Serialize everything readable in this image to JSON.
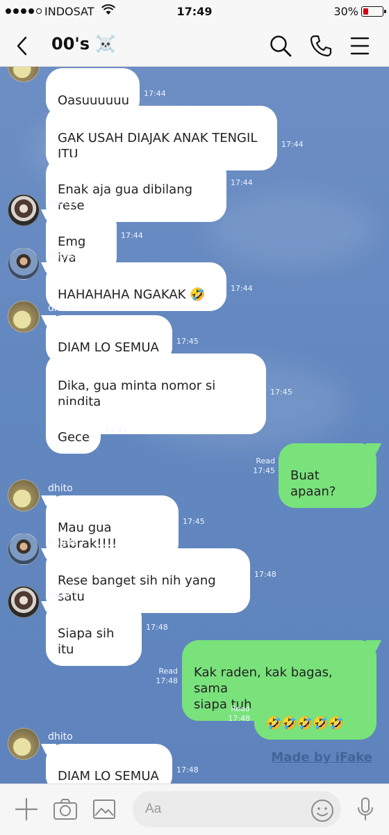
{
  "status_bar": {
    "carrier": "INDOSAT",
    "time": "17:49",
    "battery": "30%",
    "battery_level": 0.3
  },
  "header": {
    "title": "00's ☠️"
  },
  "messages": [
    {
      "text": "Oasuuuuuu",
      "time": "17:44"
    },
    {
      "text": "GAK USAH DIAJAK ANAK TENGIL\nITU",
      "time": "17:44"
    },
    {
      "text": "Enak aja gua dibilang rese",
      "time": "17:44"
    },
    {
      "sender": "raden",
      "text": "Emg iya",
      "time": "17:44"
    },
    {
      "sender": "bagas",
      "text": "HAHAHAHA NGAKAK 🤣",
      "time": "17:44"
    },
    {
      "sender": "dhito",
      "text": "DIAM LO SEMUA",
      "time": "17:45"
    },
    {
      "text": "Dika, gua minta nomor si nindita\nitu",
      "time": "17:45"
    },
    {
      "text": "Gece",
      "time": "17:45"
    },
    {
      "text": "Buat apaan?",
      "time": "17:45",
      "read": "Read"
    },
    {
      "sender": "dhito",
      "text": "Mau gua labrak!!!!",
      "time": "17:45"
    },
    {
      "sender": "bagas",
      "text": "Rese banget sih nih yang satu",
      "time": "17:48"
    },
    {
      "sender": "raden",
      "text": "Siapa sih itu",
      "time": "17:48"
    },
    {
      "text": "Kak raden, kak bagas, sama\nsiapa tuh yang rese",
      "time": "17:48",
      "read": "Read"
    },
    {
      "text": "🤣🤣🤣🤣🤣",
      "time": "17:48",
      "read": "Read"
    },
    {
      "sender": "dhito",
      "text": "DIAM LO SEMUA",
      "time": "17:48"
    }
  ],
  "watermark": "Made by iFake",
  "input": {
    "placeholder": "Aa"
  },
  "icons": [
    "back-icon",
    "search-icon",
    "phone-icon",
    "menu-icon",
    "plus-icon",
    "camera-icon",
    "image-icon",
    "sticker-icon",
    "mic-icon"
  ],
  "colors": {
    "chat_background": "#6388c0",
    "outgoing_bubble": "#79e27b",
    "incoming_bubble": "#ffffff",
    "battery": "#d0021b"
  }
}
